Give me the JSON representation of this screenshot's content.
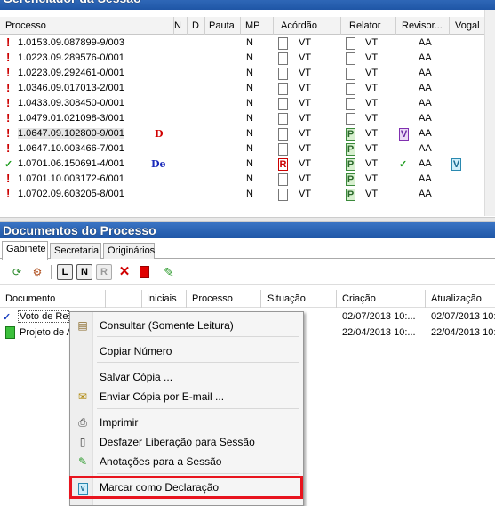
{
  "top_panel": {
    "title": "Gerenciador da Sessão",
    "columns": [
      "Processo",
      "N",
      "D",
      "Pauta",
      "MP",
      "Acórdão",
      "Relator",
      "Revisor...",
      "Vogal"
    ],
    "rows": [
      {
        "marker": "!",
        "processo": "1.0153.09.087899-9/003",
        "flag": "",
        "mp": "N",
        "acordao_icon": "blank",
        "acordao": "VT",
        "relator_icon": "blank",
        "relator": "VT",
        "revisor_icon": "",
        "revisor": "AA",
        "vogal_icon": ""
      },
      {
        "marker": "!",
        "processo": "1.0223.09.289576-0/001",
        "flag": "",
        "mp": "N",
        "acordao_icon": "blank",
        "acordao": "VT",
        "relator_icon": "blank",
        "relator": "VT",
        "revisor_icon": "",
        "revisor": "AA",
        "vogal_icon": ""
      },
      {
        "marker": "!",
        "processo": "1.0223.09.292461-0/001",
        "flag": "",
        "mp": "N",
        "acordao_icon": "blank",
        "acordao": "VT",
        "relator_icon": "blank",
        "relator": "VT",
        "revisor_icon": "",
        "revisor": "AA",
        "vogal_icon": ""
      },
      {
        "marker": "!",
        "processo": "1.0346.09.017013-2/001",
        "flag": "",
        "mp": "N",
        "acordao_icon": "blank",
        "acordao": "VT",
        "relator_icon": "blank",
        "relator": "VT",
        "revisor_icon": "",
        "revisor": "AA",
        "vogal_icon": ""
      },
      {
        "marker": "!",
        "processo": "1.0433.09.308450-0/001",
        "flag": "",
        "mp": "N",
        "acordao_icon": "blank",
        "acordao": "VT",
        "relator_icon": "blank",
        "relator": "VT",
        "revisor_icon": "",
        "revisor": "AA",
        "vogal_icon": ""
      },
      {
        "marker": "!",
        "processo": "1.0479.01.021098-3/001",
        "flag": "",
        "mp": "N",
        "acordao_icon": "blank",
        "acordao": "VT",
        "relator_icon": "blank",
        "relator": "VT",
        "revisor_icon": "",
        "revisor": "AA",
        "vogal_icon": ""
      },
      {
        "marker": "!",
        "processo": "1.0647.09.102800-9/001",
        "flag": "D",
        "flag_color": "#d10000",
        "selected": true,
        "mp": "N",
        "acordao_icon": "blank",
        "acordao": "VT",
        "relator_icon": "P",
        "relator": "VT",
        "revisor_icon": "V",
        "revisor": "AA",
        "vogal_icon": ""
      },
      {
        "marker": "!",
        "processo": "1.0647.10.003466-7/001",
        "flag": "",
        "mp": "N",
        "acordao_icon": "blank",
        "acordao": "VT",
        "relator_icon": "P",
        "relator": "VT",
        "revisor_icon": "",
        "revisor": "AA",
        "vogal_icon": ""
      },
      {
        "marker": "✓",
        "processo": "1.0701.06.150691-4/001",
        "flag": "De",
        "flag_color": "#1b2bbb",
        "mp": "N",
        "acordao_icon": "R",
        "acordao": "VT",
        "relator_icon": "P",
        "relator": "VT",
        "revisor_icon": "✓",
        "revisor": "AA",
        "vogal_icon": "V"
      },
      {
        "marker": "!",
        "processo": "1.0701.10.003172-6/001",
        "flag": "",
        "mp": "N",
        "acordao_icon": "blank",
        "acordao": "VT",
        "relator_icon": "P",
        "relator": "VT",
        "revisor_icon": "",
        "revisor": "AA",
        "vogal_icon": ""
      },
      {
        "marker": "!",
        "processo": "1.0702.09.603205-8/001",
        "flag": "",
        "mp": "N",
        "acordao_icon": "blank",
        "acordao": "VT",
        "relator_icon": "P",
        "relator": "VT",
        "revisor_icon": "",
        "revisor": "AA",
        "vogal_icon": ""
      }
    ]
  },
  "bottom_panel": {
    "title": "Documentos do Processo",
    "tabs": [
      "Gabinete",
      "Secretaria",
      "Originários"
    ],
    "toolbar": {
      "l": "L",
      "n": "N",
      "r": "R"
    },
    "columns": [
      "Documento",
      "Iniciais",
      "Processo",
      "Situação",
      "Criação",
      "Atualização"
    ],
    "rows": [
      {
        "icon": "check-doc",
        "documento": "Voto de Re",
        "criacao": "02/07/2013 10:...",
        "atualizacao": "02/07/2013 10:..."
      },
      {
        "icon": "green-doc",
        "documento": "Projeto de A",
        "criacao": "22/04/2013 10:...",
        "atualizacao": "22/04/2013 10:..."
      }
    ]
  },
  "context_menu": {
    "items": [
      {
        "label": "Consultar (Somente Leitura)",
        "icon": "notebook-icon"
      },
      {
        "label": "Copiar Número",
        "icon": ""
      },
      {
        "label": "Salvar Cópia ...",
        "icon": ""
      },
      {
        "label": "Enviar Cópia por E-mail ...",
        "icon": "envelope-icon"
      },
      {
        "label": "Imprimir",
        "icon": "printer-icon"
      },
      {
        "label": "Desfazer Liberação para Sessão",
        "icon": "document-icon"
      },
      {
        "label": "Anotações para a Sessão",
        "icon": "pencil-icon"
      },
      {
        "label": "Marcar como Declaração",
        "icon": "v-document-icon"
      }
    ]
  },
  "colors": {
    "title_bar": "#2a63b5",
    "highlight_border": "#e8141e",
    "alert": "#c00000"
  }
}
